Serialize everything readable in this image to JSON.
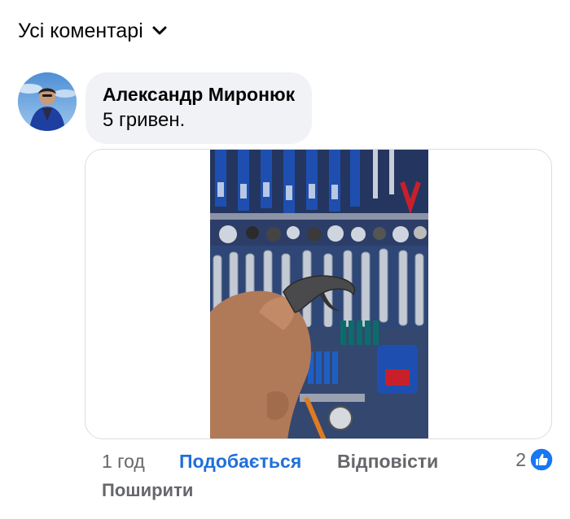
{
  "comments_filter": {
    "label": "Усі коментарі",
    "icon": "chevron-down-icon"
  },
  "comment": {
    "author": "Александр Миронюк",
    "text": "5 гривен.",
    "avatar_icon": "user-avatar",
    "attachment_icon": "photo-tool-wall",
    "time": "1 год",
    "like_label": "Подобається",
    "reply_label": "Відповісти",
    "share_label": "Поширити",
    "reaction_count": "2",
    "reaction_icon": "thumbs-up-icon"
  },
  "colors": {
    "link_blue": "#216fdb",
    "secondary_text": "#65676b",
    "bubble_bg": "#f0f2f5",
    "like_reaction": "#1877f2"
  }
}
